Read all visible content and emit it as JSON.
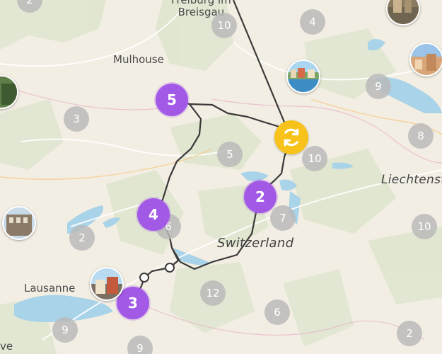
{
  "labels": {
    "freiburg": "Freiburg im\nBreisgau",
    "mulhouse": "Mulhouse",
    "lausanne": "Lausanne",
    "switzerland": "Switzerland",
    "liechtenstein": "Liechtenstein",
    "edge_left": "ve"
  },
  "clusters": {
    "c_top_left": "2",
    "c_freiburg": "10",
    "c_top_mid": "4",
    "c_west": "3",
    "c_center": "5",
    "c_east_mid": "10",
    "c_ne": "9",
    "c_east": "8",
    "c_right": "10",
    "c_lake": "7",
    "c_south_hidden": "6",
    "c_south": "12",
    "c_sw_lake": "2",
    "c_bottom_left": "9",
    "c_bottom": "9",
    "c_bottom_mid": "6",
    "c_bottom_right": "2"
  },
  "route_stops": {
    "stop_5": "5",
    "stop_4": "4",
    "stop_3": "3",
    "stop_2": "2"
  },
  "icons": {
    "sync": "sync-icon",
    "photo": "photo-marker"
  },
  "colors": {
    "route": "#3a3a3a",
    "stop": "#a259e6",
    "sync": "#f7c31a",
    "cluster": "#bababa"
  }
}
